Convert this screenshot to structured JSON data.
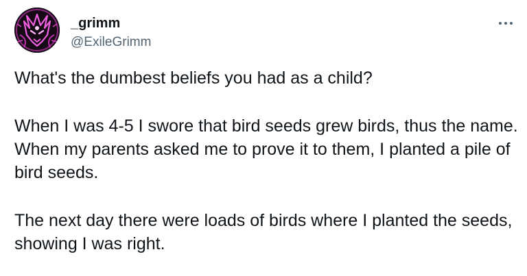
{
  "user": {
    "display_name": "_grimm",
    "handle": "@ExileGrimm",
    "avatar_icon": "pink-wolf-avatar-icon"
  },
  "menu": {
    "icon": "more-dots-icon"
  },
  "tweet": {
    "paragraphs": [
      "What's the dumbest beliefs you had as a child?",
      "When I was 4-5 I swore that bird seeds grew birds, thus the name. When my parents asked me to prove it to them, I planted a pile of bird seeds.",
      "The next day there were loads of birds where I planted the seeds, showing I was right."
    ]
  },
  "colors": {
    "text": "#0f1419",
    "secondary_text": "#536471",
    "avatar_accent": "#e040c8"
  }
}
